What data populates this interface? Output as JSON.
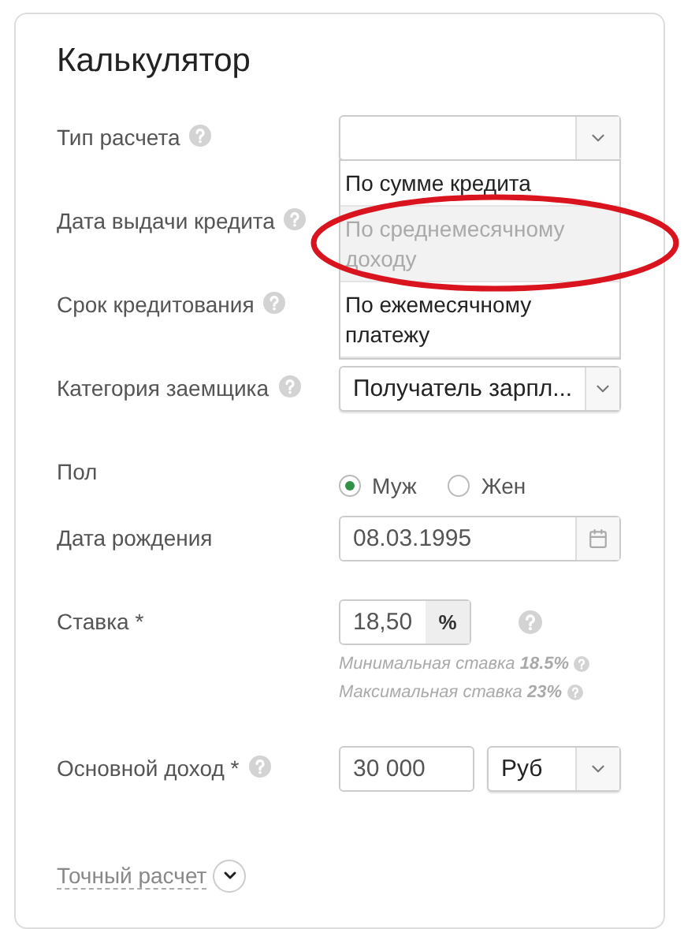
{
  "title": "Калькулятор",
  "rows": [
    {
      "kind": "dropdown",
      "label": "Тип расчета",
      "help": true,
      "value": "",
      "open": true,
      "options": [
        {
          "label": "По сумме кредита",
          "selected": false,
          "circled": false
        },
        {
          "label": "По среднемесячному доходу",
          "selected": true,
          "circled": true
        },
        {
          "label": "По ежемесячному платежу",
          "selected": false,
          "circled": false
        }
      ]
    },
    {
      "kind": "covered",
      "label": "Дата выдачи кредита",
      "help": true
    },
    {
      "kind": "covered",
      "label": "Срок кредитования",
      "help": true
    },
    {
      "kind": "dropdown",
      "label": "Категория заемщика",
      "help": true,
      "value": "Получатель зарпл...",
      "open": false
    },
    {
      "kind": "radio",
      "label": "Пол",
      "help": false,
      "choices": [
        {
          "label": "Муж",
          "selected": true
        },
        {
          "label": "Жен",
          "selected": false
        }
      ]
    },
    {
      "kind": "date",
      "label": "Дата рождения",
      "help": false,
      "value": "08.03.1995"
    },
    {
      "kind": "rate",
      "label": "Ставка *",
      "help": false,
      "value": "18,50",
      "unit": "%",
      "hints": [
        "Минимальная ставка **18.5%**",
        "Максимальная ставка **23%**"
      ]
    },
    {
      "kind": "income",
      "label": "Основной доход *",
      "help": true,
      "value": "30 000",
      "currency": "Руб"
    }
  ],
  "toggle": {
    "label": "Точный расчет",
    "expanded": false
  }
}
